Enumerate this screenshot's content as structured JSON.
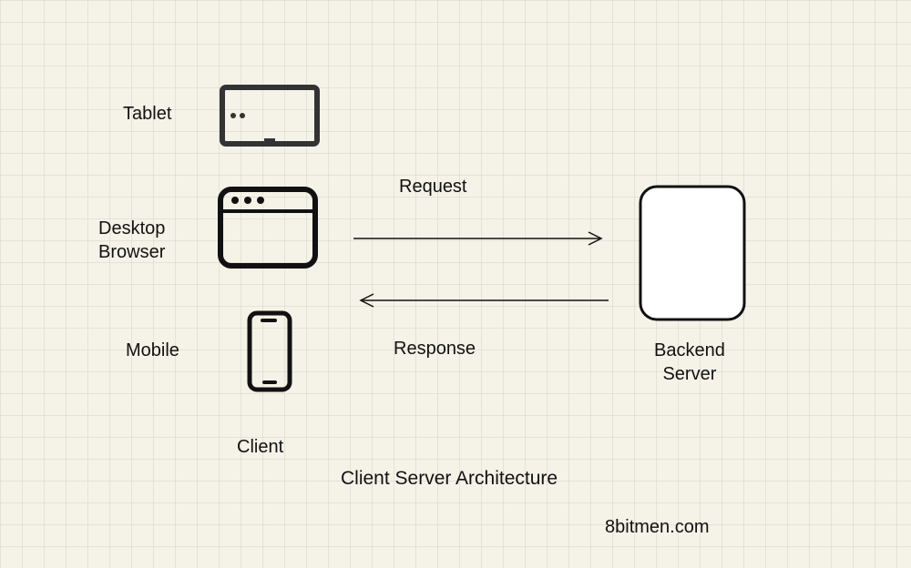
{
  "labels": {
    "tablet": "Tablet",
    "desktop_browser": "Desktop\nBrowser",
    "mobile": "Mobile",
    "client": "Client",
    "request": "Request",
    "response": "Response",
    "backend_server": "Backend\nServer",
    "title": "Client Server Architecture",
    "attribution": "8bitmen.com"
  },
  "icons": {
    "tablet": "tablet-icon",
    "browser": "browser-window-icon",
    "mobile": "smartphone-icon",
    "server": "server-icon"
  },
  "arrows": {
    "request": {
      "from": "client",
      "to": "server",
      "direction": "right"
    },
    "response": {
      "from": "server",
      "to": "client",
      "direction": "left"
    }
  }
}
